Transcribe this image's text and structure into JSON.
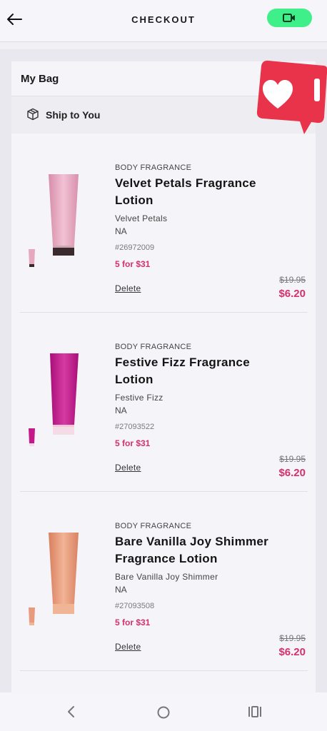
{
  "header": {
    "title": "CHECKOUT",
    "video_button_color": "#3ff08a"
  },
  "bag": {
    "title": "My Bag",
    "ship_label": "Ship to You"
  },
  "items": [
    {
      "category": "BODY FRAGRANCE",
      "name": "Velvet Petals Fragrance Lotion",
      "variant": "Velvet Petals",
      "size": "NA",
      "sku": "#26972009",
      "promo": "5 for $31",
      "delete": "Delete",
      "original_price": "$19.95",
      "price": "$6.20",
      "color": "#e7a8bf"
    },
    {
      "category": "BODY FRAGRANCE",
      "name": "Festive Fizz Fragrance Lotion",
      "variant": "Festive Fizz",
      "size": "NA",
      "sku": "#27093522",
      "promo": "5 for $31",
      "delete": "Delete",
      "original_price": "$19.95",
      "price": "$6.20",
      "color": "#c3198b"
    },
    {
      "category": "BODY FRAGRANCE",
      "name": "Bare Vanilla Joy Shimmer Fragrance Lotion",
      "variant": "Bare Vanilla Joy Shimmer",
      "size": "NA",
      "sku": "#27093508",
      "promo": "5 for $31",
      "delete": "Delete",
      "original_price": "$19.95",
      "price": "$6.20",
      "color": "#e99a7c"
    }
  ],
  "colors": {
    "accent": "#d4306e",
    "sticker": "#e8334a"
  },
  "icons": {
    "back": "arrow-left",
    "video": "video-camera",
    "ship": "package-box",
    "like": "heart-like-sticker"
  }
}
